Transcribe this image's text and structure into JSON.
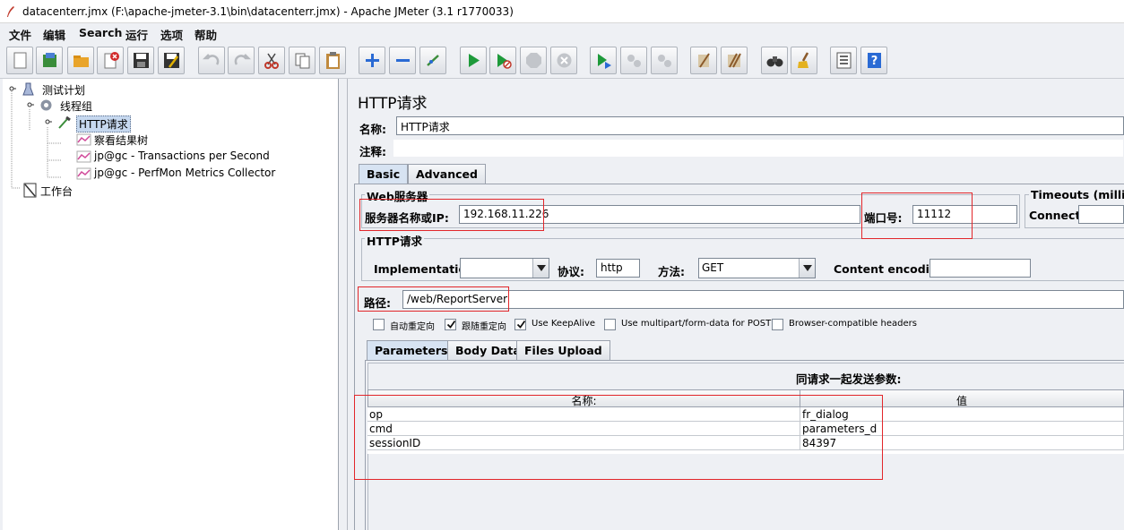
{
  "window": {
    "title": "datacenterr.jmx (F:\\apache-jmeter-3.1\\bin\\datacenterr.jmx) - Apache JMeter (3.1 r1770033)"
  },
  "menu": {
    "items": [
      "文件",
      "编辑",
      "Search",
      "运行",
      "选项",
      "帮助"
    ]
  },
  "toolbar": {
    "buttons": [
      "new-icon",
      "templates-icon",
      "open-icon",
      "close-icon",
      "save-icon",
      "save-as-icon",
      "undo-icon",
      "redo-icon",
      "cut-icon",
      "copy-icon",
      "paste-icon",
      "expand-icon",
      "collapse-icon",
      "toggle-icon",
      "start-icon",
      "start-no-pause-icon",
      "stop-icon",
      "shutdown-icon",
      "remote-start-icon",
      "remote-stop-icon",
      "remote-shutdown-icon",
      "clear-icon",
      "clear-all-icon",
      "search-icon",
      "reset-search-icon",
      "function-helper-icon",
      "help-icon"
    ]
  },
  "tree": {
    "test_plan": "测试计划",
    "thread_group": "线程组",
    "http_request": "HTTP请求",
    "listeners": [
      "察看结果树",
      "jp@gc - Transactions per Second",
      "jp@gc - PerfMon Metrics Collector"
    ],
    "workbench": "工作台"
  },
  "panel": {
    "title": "HTTP请求",
    "name_label": "名称:",
    "name_value": "HTTP请求",
    "comment_label": "注释:",
    "comment_value": "",
    "tabs": [
      "Basic",
      "Advanced"
    ],
    "web_server": {
      "group_title": "Web服务器",
      "server_label": "服务器名称或IP:",
      "server_value": "192.168.11.226",
      "port_label": "端口号:",
      "port_value": "11112"
    },
    "timeouts": {
      "group_title": "Timeouts (millisec",
      "connect_label": "Connect:",
      "connect_value": ""
    },
    "http_request": {
      "group_title": "HTTP请求",
      "implementation_label": "Implementation:",
      "implementation_value": "",
      "protocol_label": "协议:",
      "protocol_value": "http",
      "method_label": "方法:",
      "method_value": "GET",
      "encoding_label": "Content encoding:",
      "encoding_value": "",
      "path_label": "路径:",
      "path_value": "/web/ReportServer"
    },
    "options": [
      {
        "label": "自动重定向",
        "checked": false
      },
      {
        "label": "跟随重定向",
        "checked": true
      },
      {
        "label": "Use KeepAlive",
        "checked": true
      },
      {
        "label": "Use multipart/form-data for POST",
        "checked": false
      },
      {
        "label": "Browser-compatible headers",
        "checked": false
      }
    ],
    "param_tabs": [
      "Parameters",
      "Body Data",
      "Files Upload"
    ],
    "params_caption": "同请求一起发送参数:",
    "params_columns": [
      "名称:",
      "值"
    ],
    "params_rows": [
      {
        "name": "op",
        "value": "fr_dialog"
      },
      {
        "name": "cmd",
        "value": "parameters_d"
      },
      {
        "name": "sessionID",
        "value": "84397"
      }
    ]
  },
  "colors": {
    "highlight": "#e2262a",
    "selection": "#c6d8ef",
    "tab_active": "#d7e3f2"
  }
}
